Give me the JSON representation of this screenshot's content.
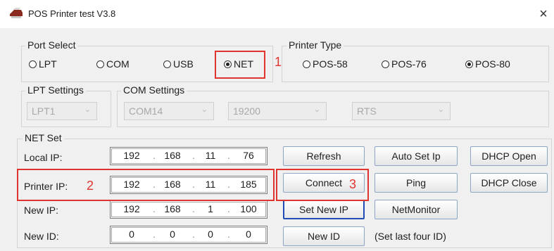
{
  "window": {
    "title": "POS Printer test V3.8",
    "close_glyph": "×",
    "icon": "printer-icon"
  },
  "port_select": {
    "legend": "Port Select",
    "options": [
      {
        "label": "LPT",
        "selected": false
      },
      {
        "label": "COM",
        "selected": false
      },
      {
        "label": "USB",
        "selected": false
      },
      {
        "label": "NET",
        "selected": true
      }
    ]
  },
  "printer_type": {
    "legend": "Printer Type",
    "options": [
      {
        "label": "POS-58",
        "selected": false
      },
      {
        "label": "POS-76",
        "selected": false
      },
      {
        "label": "POS-80",
        "selected": true
      }
    ]
  },
  "lpt_settings": {
    "legend": "LPT Settings",
    "port": "LPT1"
  },
  "com_settings": {
    "legend": "COM Settings",
    "port": "COM14",
    "baud": "19200",
    "flow": "RTS"
  },
  "net_set": {
    "legend": "NET Set",
    "local_ip": {
      "label": "Local IP:",
      "octets": [
        "192",
        "168",
        "11",
        "76"
      ]
    },
    "printer_ip": {
      "label": "Printer IP:",
      "octets": [
        "192",
        "168",
        "11",
        "185"
      ]
    },
    "new_ip": {
      "label": "New IP:",
      "octets": [
        "192",
        "168",
        "1",
        "100"
      ]
    },
    "new_id": {
      "label": "New ID:",
      "octets": [
        "0",
        "0",
        "0",
        "0"
      ]
    },
    "ip_separator": "."
  },
  "buttons": {
    "refresh": "Refresh",
    "auto_set_ip": "Auto Set Ip",
    "dhcp_open": "DHCP Open",
    "connect": "Connect",
    "ping": "Ping",
    "dhcp_close": "DHCP Close",
    "set_new_ip": "Set New IP",
    "net_monitor": "NetMonitor",
    "new_id": "New ID"
  },
  "hints": {
    "set_last_four_id": "(Set last four ID)"
  },
  "annotations": {
    "one": "1",
    "two": "2",
    "three": "3",
    "color": "#e0352e"
  }
}
